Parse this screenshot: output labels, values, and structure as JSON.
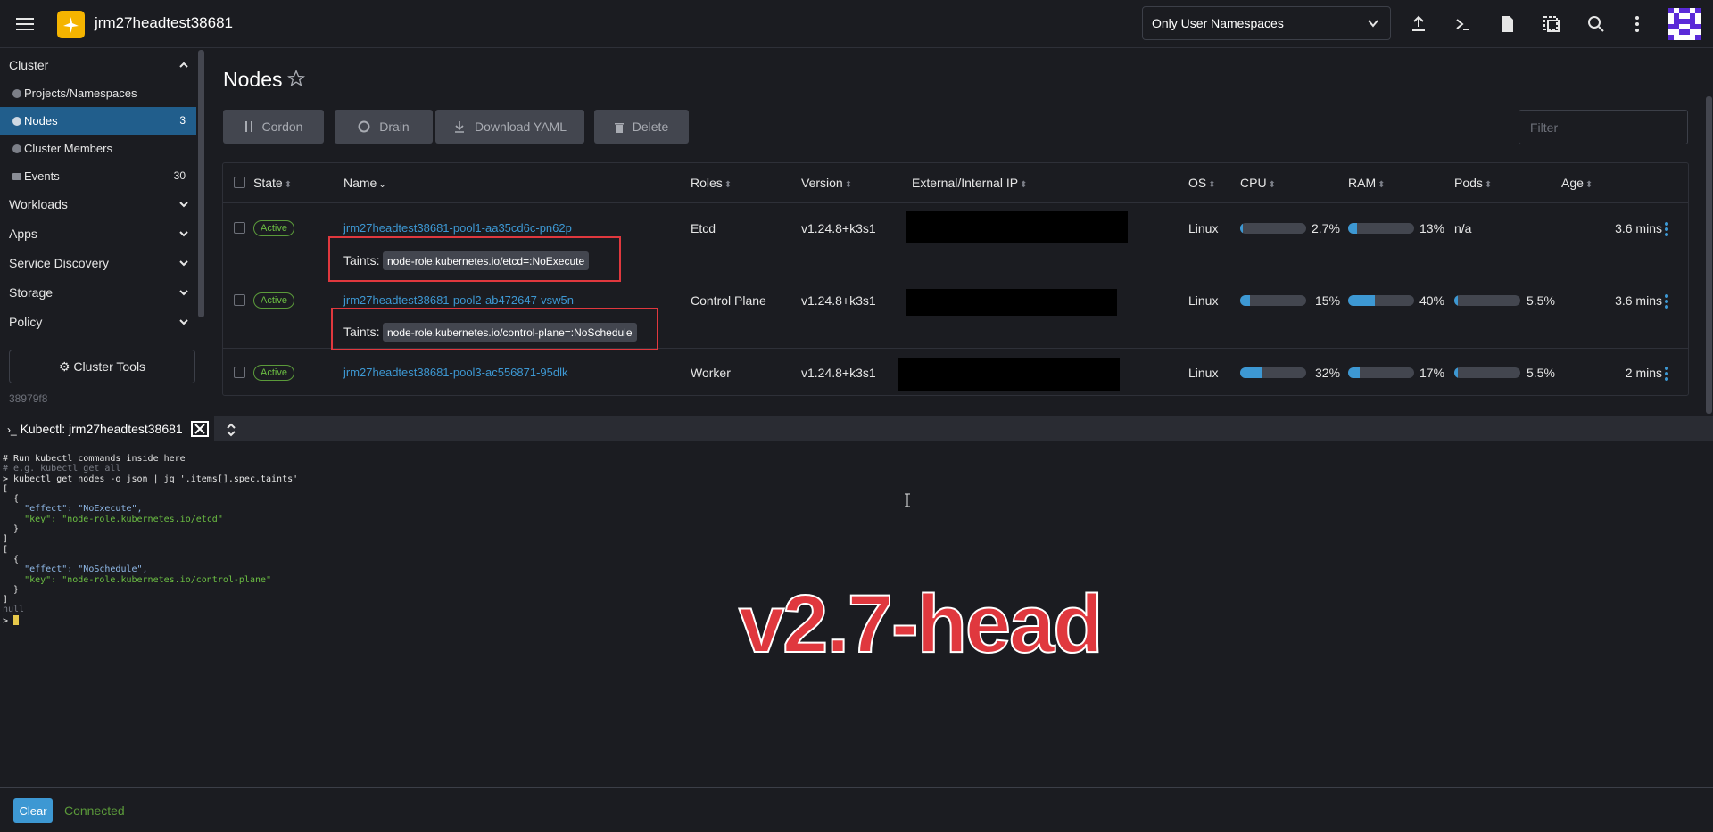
{
  "header": {
    "cluster_name": "jrm27headtest38681",
    "namespace_filter": "Only User Namespaces"
  },
  "sidebar": {
    "group_cluster": "Cluster",
    "items": [
      {
        "label": "Projects/Namespaces",
        "count": ""
      },
      {
        "label": "Nodes",
        "count": "3"
      },
      {
        "label": "Cluster Members",
        "count": ""
      },
      {
        "label": "Events",
        "count": "30"
      }
    ],
    "groups": [
      "Workloads",
      "Apps",
      "Service Discovery",
      "Storage",
      "Policy"
    ],
    "cluster_tools": "Cluster Tools",
    "version_hash": "38979f8"
  },
  "main": {
    "title": "Nodes",
    "buttons": {
      "cordon": "Cordon",
      "drain": "Drain",
      "download": "Download YAML",
      "delete": "Delete"
    },
    "filter_placeholder": "Filter",
    "columns": [
      "State",
      "Name",
      "Roles",
      "Version",
      "External/Internal IP",
      "OS",
      "CPU",
      "RAM",
      "Pods",
      "Age"
    ],
    "taints_label": "Taints:",
    "rows": [
      {
        "state": "Active",
        "name": "jrm27headtest38681-pool1-aa35cd6c-pn62p",
        "roles": "Etcd",
        "version": "v1.24.8+k3s1",
        "os": "Linux",
        "cpu": "2.7%",
        "cpu_frac": 0.027,
        "ram": "13%",
        "ram_frac": 0.13,
        "pods": "n/a",
        "pods_frac": null,
        "age": "3.6 mins",
        "taint": "node-role.kubernetes.io/etcd=:NoExecute"
      },
      {
        "state": "Active",
        "name": "jrm27headtest38681-pool2-ab472647-vsw5n",
        "roles": "Control Plane",
        "version": "v1.24.8+k3s1",
        "os": "Linux",
        "cpu": "15%",
        "cpu_frac": 0.15,
        "ram": "40%",
        "ram_frac": 0.4,
        "pods": "5.5%",
        "pods_frac": 0.055,
        "age": "3.6 mins",
        "taint": "node-role.kubernetes.io/control-plane=:NoSchedule"
      },
      {
        "state": "Active",
        "name": "jrm27headtest38681-pool3-ac556871-95dlk",
        "roles": "Worker",
        "version": "v1.24.8+k3s1",
        "os": "Linux",
        "cpu": "32%",
        "cpu_frac": 0.32,
        "ram": "17%",
        "ram_frac": 0.17,
        "pods": "5.5%",
        "pods_frac": 0.055,
        "age": "2 mins",
        "taint": ""
      }
    ]
  },
  "shell": {
    "tab_label": "Kubectl: jrm27headtest38681",
    "terminal_lines": [
      "# Run kubectl commands inside here",
      "# e.g. kubectl get all",
      "> kubectl get nodes -o json | jq '.items[].spec.taints'",
      "[",
      "  {",
      "    \"effect\": \"NoExecute\",",
      "    \"key\": \"node-role.kubernetes.io/etcd\"",
      "  }",
      "]",
      "[",
      "  {",
      "    \"effect\": \"NoSchedule\",",
      "    \"key\": \"node-role.kubernetes.io/control-plane\"",
      "  }",
      "]",
      "null",
      "> "
    ],
    "watermark": "v2.7-head",
    "clear_label": "Clear",
    "status": "Connected"
  },
  "colors": {
    "accent": "#3d98d3",
    "active": "#6cbf43",
    "highlight": "#e0383e"
  }
}
